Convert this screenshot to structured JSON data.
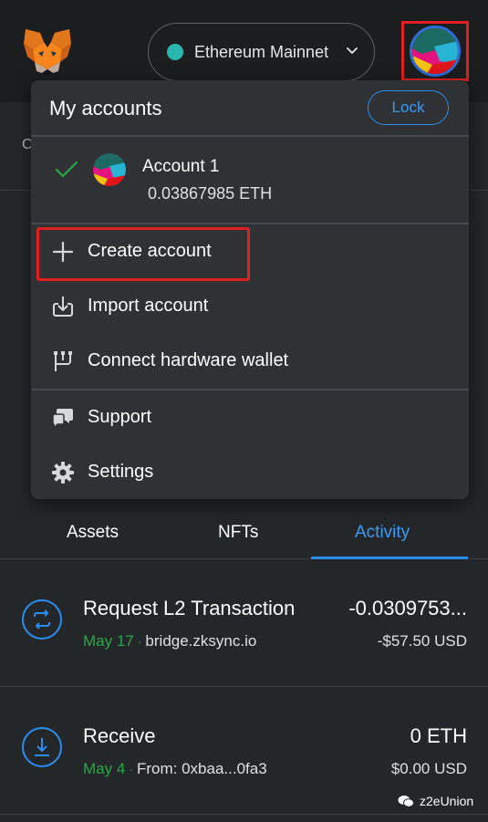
{
  "header": {
    "network_label": "Ethereum Mainnet",
    "network_color": "#29b6af",
    "icons": [
      "metamask-fox-icon",
      "chevron-down-icon",
      "account-avatar-icon"
    ]
  },
  "page": {
    "peek_text": "C"
  },
  "menu": {
    "title": "My accounts",
    "lock_label": "Lock",
    "account": {
      "name": "Account 1",
      "balance": "0.03867985 ETH",
      "selected": true
    },
    "items": [
      {
        "label": "Create account",
        "icon": "plus-icon"
      },
      {
        "label": "Import account",
        "icon": "import-icon"
      },
      {
        "label": "Connect hardware wallet",
        "icon": "hardware-wallet-icon"
      },
      {
        "label": "Support",
        "icon": "chat-bubbles-icon"
      },
      {
        "label": "Settings",
        "icon": "gear-icon"
      }
    ]
  },
  "tabs": [
    {
      "label": "Assets",
      "active": false
    },
    {
      "label": "NFTs",
      "active": false
    },
    {
      "label": "Activity",
      "active": true
    }
  ],
  "transactions": [
    {
      "title": "Request L2 Transaction",
      "amount": "-0.0309753...",
      "date": "May 17",
      "separator": "·",
      "origin": "bridge.zksync.io",
      "usd": "-$57.50 USD",
      "icon": "swap-arrows-icon"
    },
    {
      "title": "Receive",
      "amount": "0 ETH",
      "date": "May 4",
      "separator": "·",
      "origin": "From: 0xbaa...0fa3",
      "usd": "$0.00 USD",
      "icon": "download-arrow-icon"
    }
  ],
  "watermark": {
    "text": "z2eUnion"
  },
  "colors": {
    "accent": "#2b8df0",
    "highlight_border": "#e02020",
    "success_green": "#28a745",
    "background": "#24272a",
    "menu_background": "#2f3134"
  }
}
